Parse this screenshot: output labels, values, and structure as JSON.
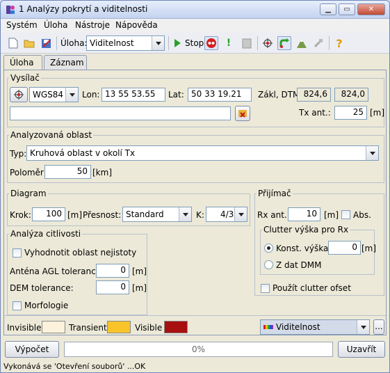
{
  "window": {
    "title": "1 Analýzy pokrytí a viditelnosti"
  },
  "menu": [
    "Systém",
    "Úloha",
    "Nástroje",
    "Nápověda"
  ],
  "toolbar": {
    "task_label": "Úloha:",
    "task_value": "Viditelnost",
    "stop_label": "Stop:"
  },
  "tabs": [
    "Úloha",
    "Záznam"
  ],
  "transmitter": {
    "legend": "Vysílač",
    "crs": "WGS84",
    "lon_label": "Lon:",
    "lon": "13 55 53.55",
    "lat_label": "Lat:",
    "lat": "50 33 19.21",
    "base_label": "Zákl, DTM",
    "base": "824,6",
    "dtm": "824,0",
    "name": "",
    "tx_label": "Tx ant.:",
    "tx": "25",
    "tx_unit": "[m]"
  },
  "area": {
    "legend": "Analyzovaná oblast",
    "type_label": "Typ:",
    "type": "Kruhová oblast v okolí Tx",
    "radius_label": "Poloměr:",
    "radius": "50",
    "radius_unit": "[km]"
  },
  "diagram": {
    "legend": "Diagram",
    "step_label": "Krok:",
    "step": "100",
    "step_unit": "[m]",
    "precision_label": "Přesnost:",
    "precision": "Standard",
    "k_label": "K:",
    "k": "4/3"
  },
  "receiver": {
    "legend": "Přijímač",
    "rx_label": "Rx ant.:",
    "rx": "10",
    "rx_unit": "[m]",
    "abs_label": "Abs.",
    "clutter_legend": "Clutter výška pro Rx",
    "const_label": "Konst. výška:",
    "const": "0",
    "const_unit": "[m]",
    "dmm_label": "Z dat DMM",
    "offset_label": "Použít clutter ofset"
  },
  "sensitivity": {
    "legend": "Analýza citlivosti",
    "uncertain_label": "Vyhodnotit oblast nejistoty",
    "agl_label": "Anténa AGL tolerance:",
    "agl": "0",
    "agl_unit": "[m]",
    "dem_label": "DEM tolerance:",
    "dem": "0",
    "dem_unit": "[m]",
    "morph_label": "Morfologie"
  },
  "legend_bar": {
    "invisible_label": "Invisible",
    "invisible_color": "#fdf2dc",
    "transient_label": "Transient",
    "transient_color": "#f8c42a",
    "visible_label": "Visible",
    "visible_color": "#a80f0f",
    "palette": "Viditelnost",
    "more": "..."
  },
  "bottom": {
    "compute": "Výpočet",
    "progress": "0%",
    "close": "Uzavřít"
  },
  "status": "Vykonává se 'Otevření souborů' ...OK"
}
